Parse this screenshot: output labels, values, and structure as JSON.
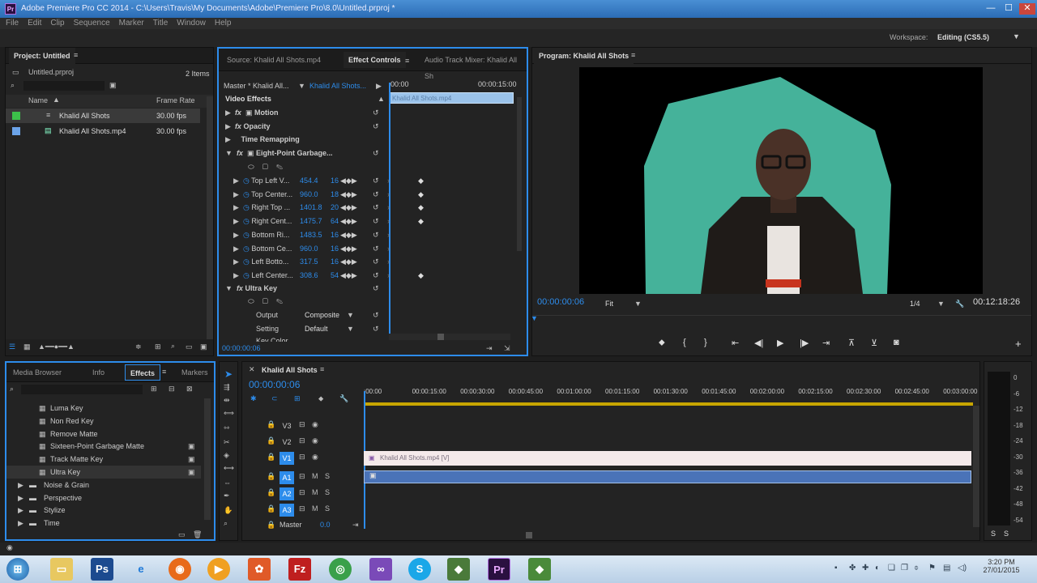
{
  "window": {
    "title": "Adobe Premiere Pro CC 2014 - C:\\Users\\Travis\\My Documents\\Adobe\\Premiere Pro\\8.0\\Untitled.prproj *",
    "app_icon": "Pr"
  },
  "menu": [
    "File",
    "Edit",
    "Clip",
    "Sequence",
    "Marker",
    "Title",
    "Window",
    "Help"
  ],
  "workspace": {
    "label": "Workspace:",
    "value": "Editing (CS5.5)"
  },
  "project": {
    "tab": "Project: Untitled",
    "file": "Untitled.prproj",
    "count": "2 Items",
    "col_name": "Name",
    "col_rate": "Frame Rate",
    "items": [
      {
        "name": "Khalid All Shots",
        "rate": "30.00 fps",
        "color": "#3cc04a"
      },
      {
        "name": "Khalid All Shots.mp4",
        "rate": "30.00 fps",
        "color": "#6ba3e8"
      }
    ]
  },
  "effect_controls": {
    "tabs": [
      "Source: Khalid All Shots.mp4",
      "Effect Controls",
      "Audio Track Mixer: Khalid All Sh"
    ],
    "master": "Master * Khalid All...",
    "clip": "Khalid All Shots...",
    "time_start": "00:00",
    "time_end": "00:00:15:00",
    "clip_bar": "Khalid All Shots.mp4",
    "section": "Video Effects",
    "effects": [
      "Motion",
      "Opacity",
      "Time Remapping",
      "Eight-Point Garbage..."
    ],
    "params": [
      {
        "name": "Top Left V...",
        "v1": "454.4",
        "v2": "16"
      },
      {
        "name": "Top Center...",
        "v1": "960.0",
        "v2": "18"
      },
      {
        "name": "Right Top ...",
        "v1": "1401.8",
        "v2": "20"
      },
      {
        "name": "Right Cent...",
        "v1": "1475.7",
        "v2": "64"
      },
      {
        "name": "Bottom Ri...",
        "v1": "1483.5",
        "v2": "16"
      },
      {
        "name": "Bottom Ce...",
        "v1": "960.0",
        "v2": "16"
      },
      {
        "name": "Left Botto...",
        "v1": "317.5",
        "v2": "16"
      },
      {
        "name": "Left Center...",
        "v1": "308.6",
        "v2": "54"
      }
    ],
    "ultra_key": "Ultra Key",
    "output_label": "Output",
    "output_value": "Composite",
    "setting_label": "Setting",
    "setting_value": "Default",
    "key_color": "Key Color",
    "timecode": "00:00:00:06"
  },
  "program": {
    "tab": "Program: Khalid All Shots",
    "timecode": "00:00:00:06",
    "fit": "Fit",
    "ratio": "1/4",
    "duration": "00:12:18:26"
  },
  "effects_panel": {
    "tabs": [
      "Media Browser",
      "Info",
      "Effects",
      "Markers"
    ],
    "items": [
      {
        "label": "Luma Key",
        "type": "fx"
      },
      {
        "label": "Non Red Key",
        "type": "fx"
      },
      {
        "label": "Remove Matte",
        "type": "fx"
      },
      {
        "label": "Sixteen-Point Garbage Matte",
        "type": "fx"
      },
      {
        "label": "Track Matte Key",
        "type": "fx"
      },
      {
        "label": "Ultra Key",
        "type": "fx"
      },
      {
        "label": "Noise & Grain",
        "type": "folder"
      },
      {
        "label": "Perspective",
        "type": "folder"
      },
      {
        "label": "Stylize",
        "type": "folder"
      },
      {
        "label": "Time",
        "type": "folder"
      }
    ]
  },
  "timeline": {
    "tab": "Khalid All Shots",
    "timecode": "00:00:00:06",
    "ruler": [
      ":00:00",
      "00:00:15:00",
      "00:00:30:00",
      "00:00:45:00",
      "00:01:00:00",
      "00:01:15:00",
      "00:01:30:00",
      "00:01:45:00",
      "00:02:00:00",
      "00:02:15:00",
      "00:02:30:00",
      "00:02:45:00",
      "00:03:00:00"
    ],
    "video_tracks": [
      "V3",
      "V2",
      "V1"
    ],
    "audio_tracks": [
      "A1",
      "A2",
      "A3"
    ],
    "master": "Master",
    "master_val": "0.0",
    "clip_v": "Khalid All Shots.mp4 [V]",
    "m": "M",
    "s": "S"
  },
  "meters": {
    "labels": [
      "0",
      "-6",
      "-12",
      "-18",
      "-24",
      "-30",
      "-36",
      "-42",
      "-48",
      "-54"
    ],
    "ss": "S"
  },
  "taskbar": {
    "time": "3:20 PM",
    "date": "27/01/2015"
  },
  "colors": {
    "accent": "#2d8ceb",
    "panel": "#232323",
    "matte": "#45b29a"
  }
}
